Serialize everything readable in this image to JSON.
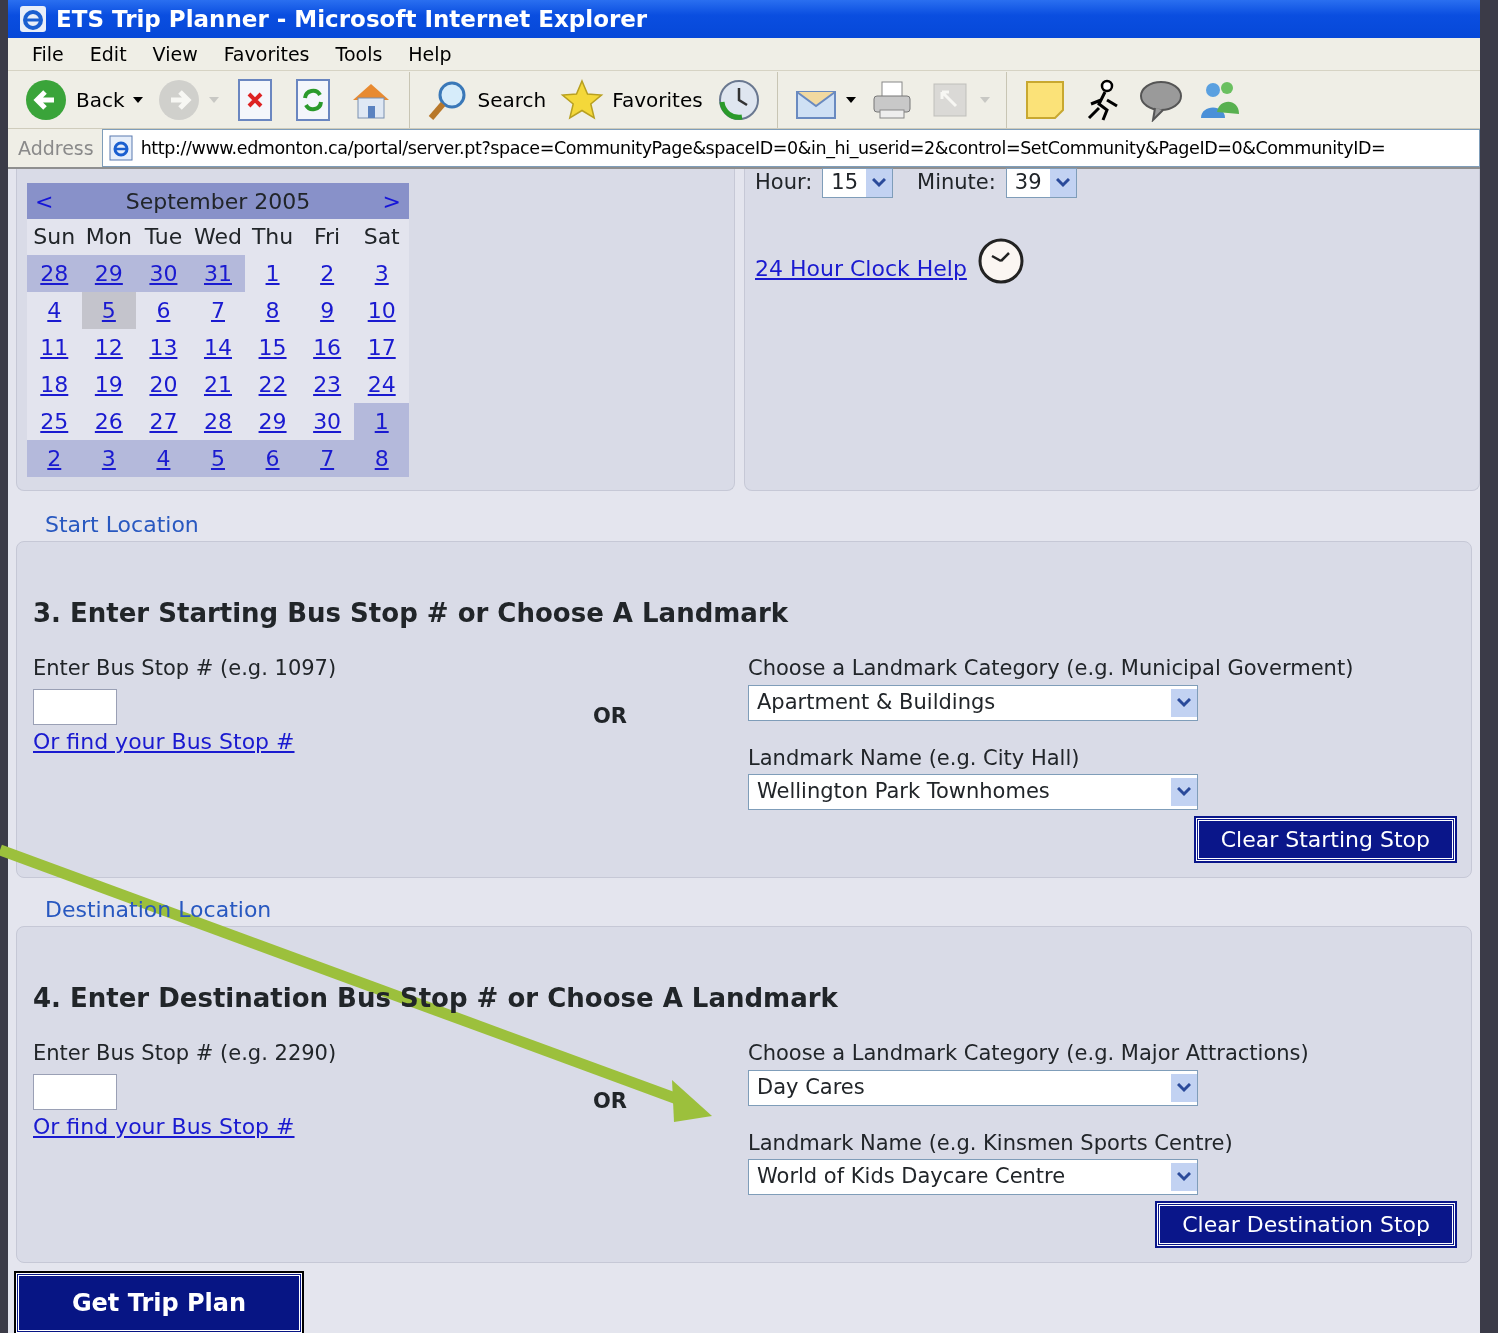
{
  "window": {
    "title": "ETS Trip Planner - Microsoft Internet Explorer"
  },
  "menu": [
    "File",
    "Edit",
    "View",
    "Favorites",
    "Tools",
    "Help"
  ],
  "toolbar": [
    {
      "kind": "back",
      "label": "Back",
      "has_menu": true,
      "disabled": false
    },
    {
      "kind": "forward",
      "has_menu": true,
      "disabled": true
    },
    {
      "kind": "stop",
      "has_menu": false,
      "disabled": false
    },
    {
      "kind": "refresh",
      "has_menu": false,
      "disabled": false
    },
    {
      "kind": "home",
      "has_menu": false,
      "disabled": false
    },
    {
      "kind": "search",
      "label": "Search",
      "has_menu": false,
      "disabled": false
    },
    {
      "kind": "favorites",
      "label": "Favorites",
      "has_menu": false,
      "disabled": false
    },
    {
      "kind": "history",
      "has_menu": false,
      "disabled": false
    },
    {
      "kind": "mail",
      "has_menu": true,
      "disabled": false
    },
    {
      "kind": "print",
      "has_menu": false,
      "disabled": false
    },
    {
      "kind": "fullscreen",
      "has_menu": true,
      "disabled": true
    },
    {
      "kind": "note",
      "has_menu": false,
      "disabled": false
    },
    {
      "kind": "runner",
      "has_menu": false,
      "disabled": false
    },
    {
      "kind": "chat",
      "has_menu": false,
      "disabled": false
    },
    {
      "kind": "messenger",
      "has_menu": false,
      "disabled": false
    }
  ],
  "address": {
    "label": "Address",
    "url": "http://www.edmonton.ca/portal/server.pt?space=CommunityPage&spaceID=0&in_hi_userid=2&control=SetCommunity&PageID=0&CommunityID="
  },
  "calendar": {
    "prev": "<",
    "month": "September 2005",
    "next": ">",
    "weekdays": [
      "Sun",
      "Mon",
      "Tue",
      "Wed",
      "Thu",
      "Fri",
      "Sat"
    ],
    "days": [
      {
        "day": "28",
        "other_month": true,
        "selected": false
      },
      {
        "day": "29",
        "other_month": true,
        "selected": false
      },
      {
        "day": "30",
        "other_month": true,
        "selected": false
      },
      {
        "day": "31",
        "other_month": true,
        "selected": false
      },
      {
        "day": "1",
        "other_month": false,
        "selected": false
      },
      {
        "day": "2",
        "other_month": false,
        "selected": false
      },
      {
        "day": "3",
        "other_month": false,
        "selected": false
      },
      {
        "day": "4",
        "other_month": false,
        "selected": false
      },
      {
        "day": "5",
        "other_month": false,
        "selected": true
      },
      {
        "day": "6",
        "other_month": false,
        "selected": false
      },
      {
        "day": "7",
        "other_month": false,
        "selected": false
      },
      {
        "day": "8",
        "other_month": false,
        "selected": false
      },
      {
        "day": "9",
        "other_month": false,
        "selected": false
      },
      {
        "day": "10",
        "other_month": false,
        "selected": false
      },
      {
        "day": "11",
        "other_month": false,
        "selected": false
      },
      {
        "day": "12",
        "other_month": false,
        "selected": false
      },
      {
        "day": "13",
        "other_month": false,
        "selected": false
      },
      {
        "day": "14",
        "other_month": false,
        "selected": false
      },
      {
        "day": "15",
        "other_month": false,
        "selected": false
      },
      {
        "day": "16",
        "other_month": false,
        "selected": false
      },
      {
        "day": "17",
        "other_month": false,
        "selected": false
      },
      {
        "day": "18",
        "other_month": false,
        "selected": false
      },
      {
        "day": "19",
        "other_month": false,
        "selected": false
      },
      {
        "day": "20",
        "other_month": false,
        "selected": false
      },
      {
        "day": "21",
        "other_month": false,
        "selected": false
      },
      {
        "day": "22",
        "other_month": false,
        "selected": false
      },
      {
        "day": "23",
        "other_month": false,
        "selected": false
      },
      {
        "day": "24",
        "other_month": false,
        "selected": false
      },
      {
        "day": "25",
        "other_month": false,
        "selected": false
      },
      {
        "day": "26",
        "other_month": false,
        "selected": false
      },
      {
        "day": "27",
        "other_month": false,
        "selected": false
      },
      {
        "day": "28",
        "other_month": false,
        "selected": false
      },
      {
        "day": "29",
        "other_month": false,
        "selected": false
      },
      {
        "day": "30",
        "other_month": false,
        "selected": false
      },
      {
        "day": "1",
        "other_month": true,
        "selected": false
      },
      {
        "day": "2",
        "other_month": true,
        "selected": false
      },
      {
        "day": "3",
        "other_month": true,
        "selected": false
      },
      {
        "day": "4",
        "other_month": true,
        "selected": false
      },
      {
        "day": "5",
        "other_month": true,
        "selected": false
      },
      {
        "day": "6",
        "other_month": true,
        "selected": false
      },
      {
        "day": "7",
        "other_month": true,
        "selected": false
      },
      {
        "day": "8",
        "other_month": true,
        "selected": false
      }
    ]
  },
  "time": {
    "hour_label": "Hour:",
    "hour": "15",
    "minute_label": "Minute:",
    "minute": "39",
    "help_link": "24 Hour Clock Help"
  },
  "sections": [
    {
      "legend": "Start Location",
      "heading": "3. Enter Starting Bus Stop # or Choose A Landmark",
      "stop_label": "Enter Bus Stop # (e.g. 1097)",
      "find_link": "Or find your Bus Stop #",
      "or": "OR",
      "category_label": "Choose a Landmark Category (e.g. Municipal Goverment)",
      "category": "Apartment & Buildings",
      "name_label": "Landmark Name (e.g. City Hall)",
      "name": "Wellington Park Townhomes",
      "clear_button": "Clear Starting Stop"
    },
    {
      "legend": "Destination Location",
      "heading": "4. Enter Destination Bus Stop # or Choose A Landmark",
      "stop_label": "Enter Bus Stop # (e.g. 2290)",
      "find_link": "Or find your Bus Stop #",
      "or": "OR",
      "category_label": "Choose a Landmark Category (e.g. Major Attractions)",
      "category": "Day Cares",
      "name_label": "Landmark Name (e.g. Kinsmen Sports Centre)",
      "name": "World of Kids Daycare Centre",
      "clear_button": "Clear Destination Stop"
    }
  ],
  "submit": "Get Trip Plan"
}
